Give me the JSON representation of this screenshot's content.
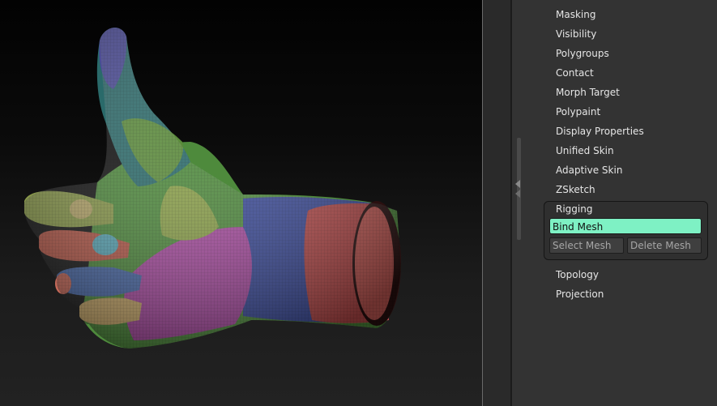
{
  "menu": {
    "items": [
      {
        "label": "Masking"
      },
      {
        "label": "Visibility"
      },
      {
        "label": "Polygroups"
      },
      {
        "label": "Contact"
      },
      {
        "label": "Morph Target"
      },
      {
        "label": "Polypaint"
      },
      {
        "label": "Display Properties"
      },
      {
        "label": "Unified Skin"
      },
      {
        "label": "Adaptive Skin"
      },
      {
        "label": "ZSketch"
      }
    ],
    "rigging": {
      "label": "Rigging",
      "bind_mesh": "Bind Mesh",
      "select_mesh": "Select Mesh",
      "delete_mesh": "Delete Mesh"
    },
    "after": [
      {
        "label": "Topology"
      },
      {
        "label": "Projection"
      }
    ]
  },
  "colors": {
    "accent": "#7ef1c4",
    "panel_bg": "#333333",
    "text": "#e6e6e6"
  }
}
